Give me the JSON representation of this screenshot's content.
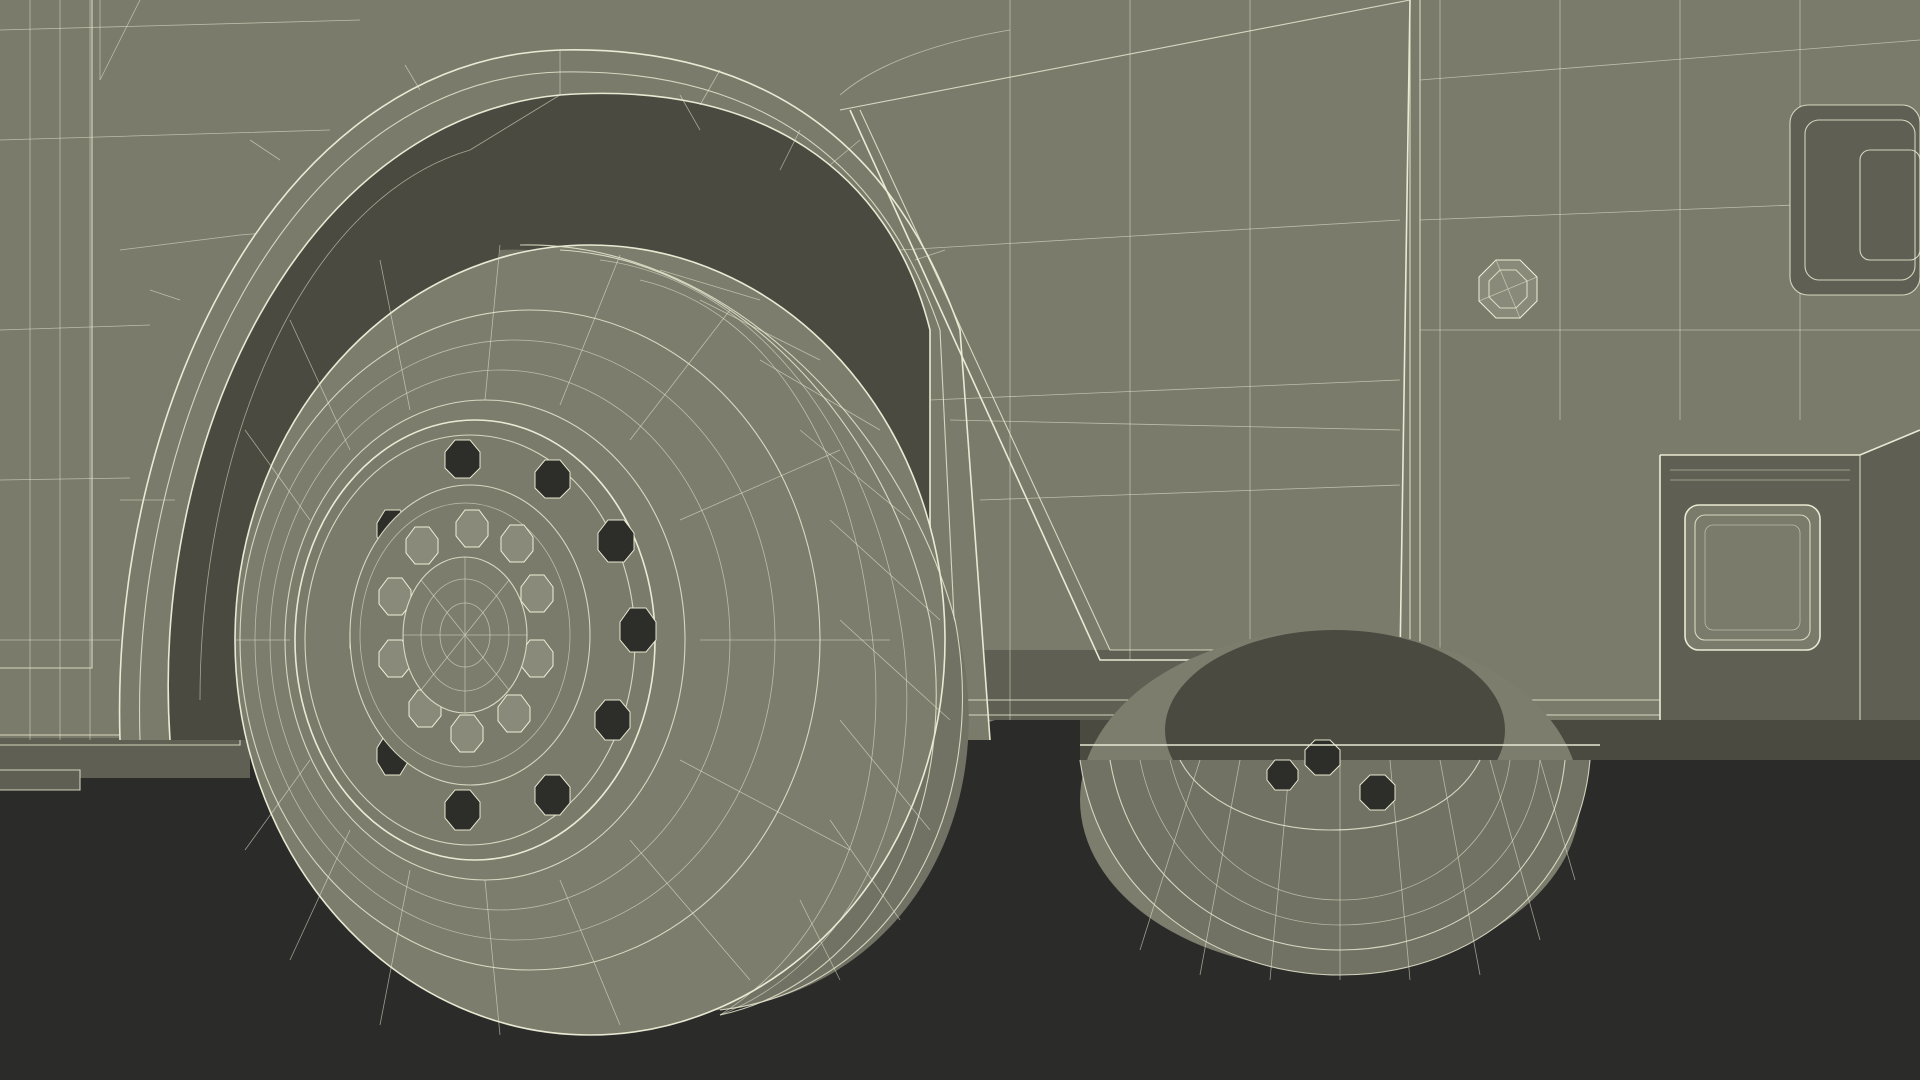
{
  "scene": {
    "subject": "",
    "render_style": "wireframe-over-shaded",
    "colors": {
      "ground": "#2b2b2a",
      "body": "#7b7b6c",
      "wire": "#e8e8d0",
      "hole": "#2d2d29"
    },
    "front_wheel": {
      "lug_holes": 10,
      "hub_bolts": 10
    },
    "rear_wheel": {
      "lug_holes_visible": 3
    }
  }
}
